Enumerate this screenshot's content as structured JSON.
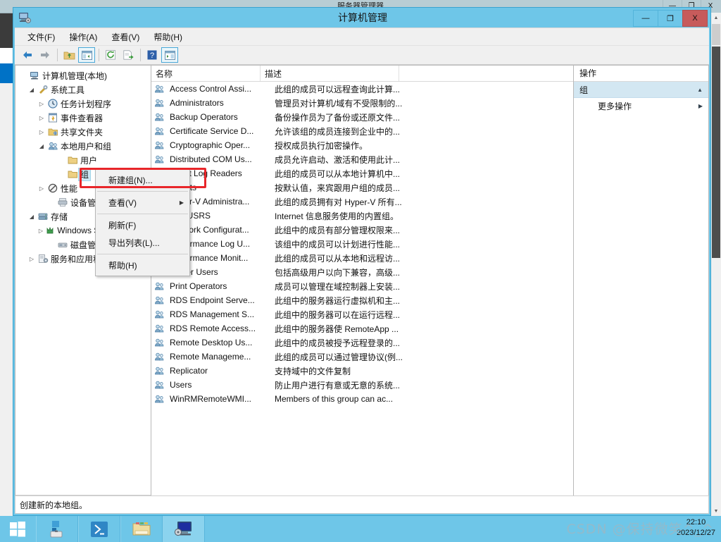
{
  "background_window": {
    "title": "服务器管理器",
    "controls": {
      "minimize": "—",
      "maximize": "❐",
      "close": "X"
    }
  },
  "window": {
    "title": "计算机管理",
    "icon": "computer-management-icon",
    "controls": {
      "minimize": "—",
      "maximize": "❐",
      "close": "X"
    }
  },
  "menubar": {
    "items": [
      {
        "label": "文件(F)"
      },
      {
        "label": "操作(A)"
      },
      {
        "label": "查看(V)"
      },
      {
        "label": "帮助(H)"
      }
    ]
  },
  "toolbar": {
    "buttons": [
      {
        "name": "back-icon",
        "glyph": "◀"
      },
      {
        "name": "forward-icon",
        "glyph": "▶"
      },
      {
        "name": "up-folder-icon",
        "glyph": "📁"
      },
      {
        "name": "show-hide-tree-icon",
        "glyph": "▤"
      },
      {
        "name": "refresh-icon",
        "glyph": "⟳"
      },
      {
        "name": "export-list-icon",
        "glyph": "▤"
      },
      {
        "name": "help-icon",
        "glyph": "?"
      },
      {
        "name": "properties-icon",
        "glyph": "▤"
      }
    ]
  },
  "tree": {
    "items": [
      {
        "label": "计算机管理(本地)",
        "indent": 0,
        "twisty": "",
        "icon": "computer-icon",
        "selected": false
      },
      {
        "label": "系统工具",
        "indent": 1,
        "twisty": "◢",
        "icon": "tools-icon",
        "selected": false
      },
      {
        "label": "任务计划程序",
        "indent": 2,
        "twisty": "▷",
        "icon": "clock-icon",
        "selected": false
      },
      {
        "label": "事件查看器",
        "indent": 2,
        "twisty": "▷",
        "icon": "event-viewer-icon",
        "selected": false
      },
      {
        "label": "共享文件夹",
        "indent": 2,
        "twisty": "▷",
        "icon": "shared-folders-icon",
        "selected": false
      },
      {
        "label": "本地用户和组",
        "indent": 2,
        "twisty": "◢",
        "icon": "local-users-groups-icon",
        "selected": false
      },
      {
        "label": "用户",
        "indent": 3,
        "twisty": "",
        "icon": "folder-icon",
        "selected": false
      },
      {
        "label": "组",
        "indent": 3,
        "twisty": "",
        "icon": "folder-icon",
        "selected": true
      },
      {
        "label": "性能",
        "indent": 2,
        "twisty": "▷",
        "icon": "performance-icon",
        "selected": false
      },
      {
        "label": "设备管理器",
        "indent": 2,
        "twisty": "",
        "icon": "device-manager-icon",
        "selected": false
      },
      {
        "label": "存储",
        "indent": 1,
        "twisty": "◢",
        "icon": "storage-icon",
        "selected": false
      },
      {
        "label": "Windows Server Backup",
        "indent": 2,
        "twisty": "▷",
        "icon": "backup-icon",
        "selected": false
      },
      {
        "label": "磁盘管理",
        "indent": 2,
        "twisty": "",
        "icon": "disk-management-icon",
        "selected": false
      },
      {
        "label": "服务和应用程序",
        "indent": 1,
        "twisty": "▷",
        "icon": "services-icon",
        "selected": false
      }
    ],
    "hscroll": {
      "left_glyph": "‹",
      "right_glyph": "›",
      "thumb_glyph": "⦀"
    }
  },
  "list": {
    "columns": [
      "名称",
      "描述"
    ],
    "rows": [
      {
        "name": "Access Control Assi...",
        "desc": "此组的成员可以远程查询此计算..."
      },
      {
        "name": "Administrators",
        "desc": "管理员对计算机/域有不受限制的..."
      },
      {
        "name": "Backup Operators",
        "desc": "备份操作员为了备份或还原文件..."
      },
      {
        "name": "Certificate Service D...",
        "desc": "允许该组的成员连接到企业中的..."
      },
      {
        "name": "Cryptographic Oper...",
        "desc": "授权成员执行加密操作。"
      },
      {
        "name": "Distributed COM Us...",
        "desc": "成员允许启动、激活和使用此计..."
      },
      {
        "name": "Event Log Readers",
        "desc": "此组的成员可以从本地计算机中..."
      },
      {
        "name": "Guests",
        "desc": "按默认值，来宾跟用户组的成员..."
      },
      {
        "name": "Hyper-V Administra...",
        "desc": "此组的成员拥有对 Hyper-V 所有..."
      },
      {
        "name": "IIS_IUSRS",
        "desc": "Internet 信息服务使用的内置组。"
      },
      {
        "name": "Network Configurat...",
        "desc": "此组中的成员有部分管理权限来..."
      },
      {
        "name": "Performance Log U...",
        "desc": "该组中的成员可以计划进行性能..."
      },
      {
        "name": "Performance Monit...",
        "desc": "此组的成员可以从本地和远程访..."
      },
      {
        "name": "Power Users",
        "desc": "包括高级用户以向下兼容，高级..."
      },
      {
        "name": "Print Operators",
        "desc": "成员可以管理在域控制器上安装..."
      },
      {
        "name": "RDS Endpoint Serve...",
        "desc": "此组中的服务器运行虚拟机和主..."
      },
      {
        "name": "RDS Management S...",
        "desc": "此组中的服务器可以在运行远程..."
      },
      {
        "name": "RDS Remote Access...",
        "desc": "此组中的服务器使 RemoteApp ..."
      },
      {
        "name": "Remote Desktop Us...",
        "desc": "此组中的成员被授予远程登录的..."
      },
      {
        "name": "Remote Manageme...",
        "desc": "此组的成员可以通过管理协议(例..."
      },
      {
        "name": "Replicator",
        "desc": "支持域中的文件复制"
      },
      {
        "name": "Users",
        "desc": "防止用户进行有意或无意的系统..."
      },
      {
        "name": "WinRMRemoteWMI...",
        "desc": "Members of this group can ac..."
      }
    ]
  },
  "actions_pane": {
    "title": "操作",
    "group_header": "组",
    "collapse_glyph": "▲",
    "items": [
      {
        "label": "更多操作",
        "arrow": "▶"
      }
    ]
  },
  "context_menu": {
    "items": [
      {
        "label": "新建组(N)...",
        "submenu": false,
        "separator_after": true
      },
      {
        "label": "查看(V)",
        "submenu": true,
        "separator_after": true
      },
      {
        "label": "刷新(F)",
        "submenu": false,
        "separator_after": false
      },
      {
        "label": "导出列表(L)...",
        "submenu": false,
        "separator_after": true
      },
      {
        "label": "帮助(H)",
        "submenu": false,
        "separator_after": false
      }
    ],
    "highlight_color": "#e8262a",
    "submenu_arrow": "▶"
  },
  "status_bar": {
    "text": "创建新的本地组。"
  },
  "taskbar": {
    "start": "windows-logo-icon",
    "items": [
      {
        "name": "server-manager-icon",
        "active": false
      },
      {
        "name": "powershell-icon",
        "active": false
      },
      {
        "name": "file-explorer-icon",
        "active": false
      },
      {
        "name": "computer-management-icon",
        "active": true
      }
    ],
    "clock": {
      "time": "22:10",
      "date": "2023/12/27"
    }
  },
  "watermark": {
    "text": "CSDN @保持微笑^_^"
  }
}
